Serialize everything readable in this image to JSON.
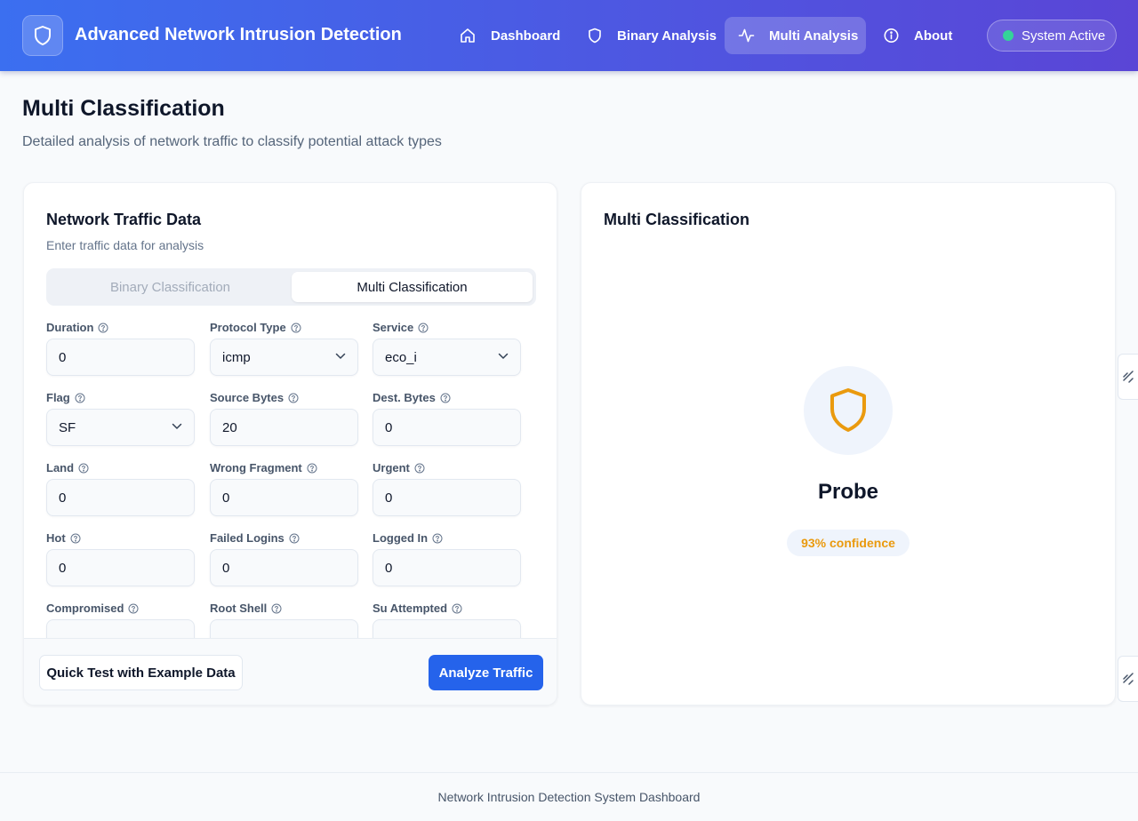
{
  "header": {
    "app_title": "Advanced Network Intrusion Detection",
    "nav": [
      {
        "label": "Dashboard",
        "icon": "home-icon"
      },
      {
        "label": "Binary Analysis",
        "icon": "shield-icon"
      },
      {
        "label": "Multi Analysis",
        "icon": "activity-icon",
        "active": true
      },
      {
        "label": "About",
        "icon": "info-icon"
      }
    ],
    "status": "System Active",
    "status_color": "#34d399"
  },
  "page": {
    "title": "Multi Classification",
    "subtitle": "Detailed analysis of network traffic to classify potential attack types"
  },
  "form_card": {
    "title": "Network Traffic Data",
    "description": "Enter traffic data for analysis",
    "tabs": [
      {
        "label": "Binary Classification",
        "active": false
      },
      {
        "label": "Multi Classification",
        "active": true
      }
    ],
    "fields": [
      {
        "label": "Duration",
        "value": "0",
        "type": "input"
      },
      {
        "label": "Protocol Type",
        "value": "icmp",
        "type": "select"
      },
      {
        "label": "Service",
        "value": "eco_i",
        "type": "select"
      },
      {
        "label": "Flag",
        "value": "SF",
        "type": "select"
      },
      {
        "label": "Source Bytes",
        "value": "20",
        "type": "input"
      },
      {
        "label": "Dest. Bytes",
        "value": "0",
        "type": "input"
      },
      {
        "label": "Land",
        "value": "0",
        "type": "input"
      },
      {
        "label": "Wrong Fragment",
        "value": "0",
        "type": "input"
      },
      {
        "label": "Urgent",
        "value": "0",
        "type": "input"
      },
      {
        "label": "Hot",
        "value": "0",
        "type": "input"
      },
      {
        "label": "Failed Logins",
        "value": "0",
        "type": "input"
      },
      {
        "label": "Logged In",
        "value": "0",
        "type": "input"
      },
      {
        "label": "Compromised",
        "value": "",
        "type": "input"
      },
      {
        "label": "Root Shell",
        "value": "",
        "type": "input"
      },
      {
        "label": "Su Attempted",
        "value": "",
        "type": "input"
      }
    ],
    "quick_test_label": "Quick Test with Example Data",
    "analyze_label": "Analyze Traffic",
    "primary_color": "#2563eb"
  },
  "result_card": {
    "title": "Multi Classification",
    "result": "Probe",
    "confidence": "93% confidence",
    "result_color": "#ea9a0e"
  },
  "footer": {
    "text": "Network Intrusion Detection System Dashboard"
  }
}
